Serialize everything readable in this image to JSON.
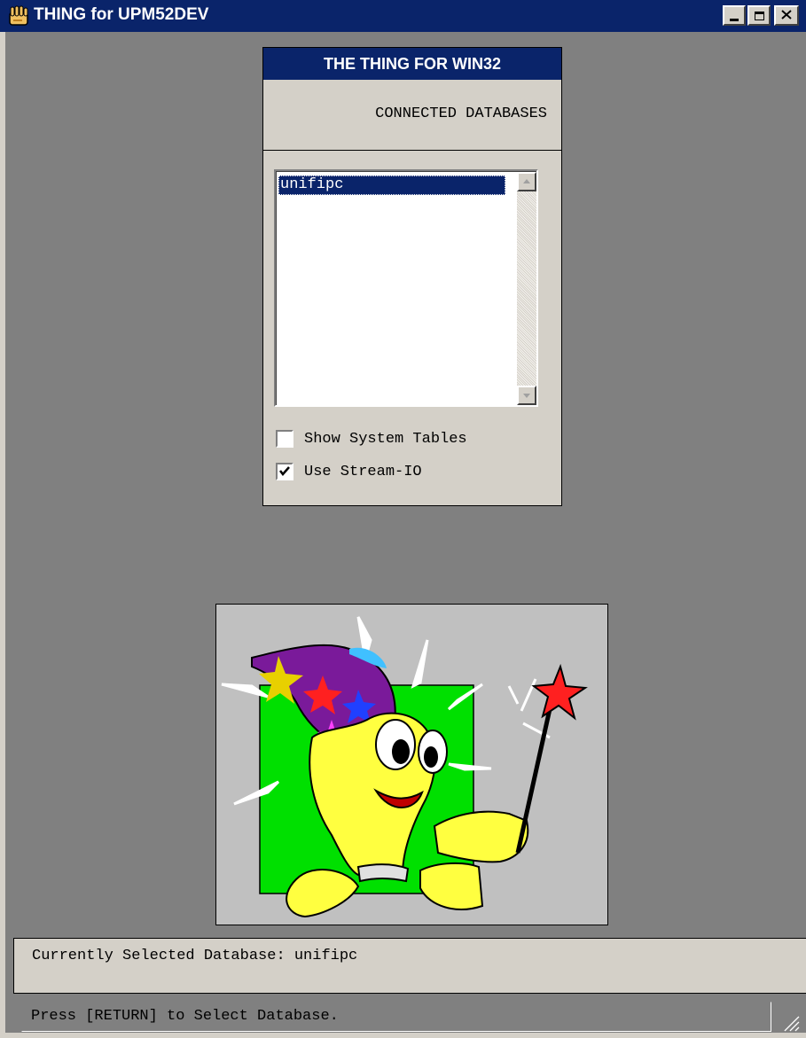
{
  "window": {
    "title": "THING for UPM52DEV",
    "controls": [
      "minimize",
      "maximize",
      "close"
    ]
  },
  "panel": {
    "header": "THE THING FOR WIN32",
    "subtitle": "CONNECTED DATABASES",
    "databases": [
      "unifipc"
    ],
    "selected_database": "unifipc",
    "checkboxes": [
      {
        "label": "Show System Tables",
        "checked": false
      },
      {
        "label": "Use Stream-IO",
        "checked": true
      }
    ]
  },
  "picture": {
    "description_icon": "wizard-lightbulb-mascot"
  },
  "status": {
    "current_db_line": "Currently Selected Database: unifipc",
    "hint": "Press [RETURN] to Select Database."
  },
  "colors": {
    "titlebar": "#0a246a",
    "client_bg": "#808080",
    "face": "#d4d0c8",
    "selection": "#0a246a",
    "picture_green": "#00e000"
  }
}
